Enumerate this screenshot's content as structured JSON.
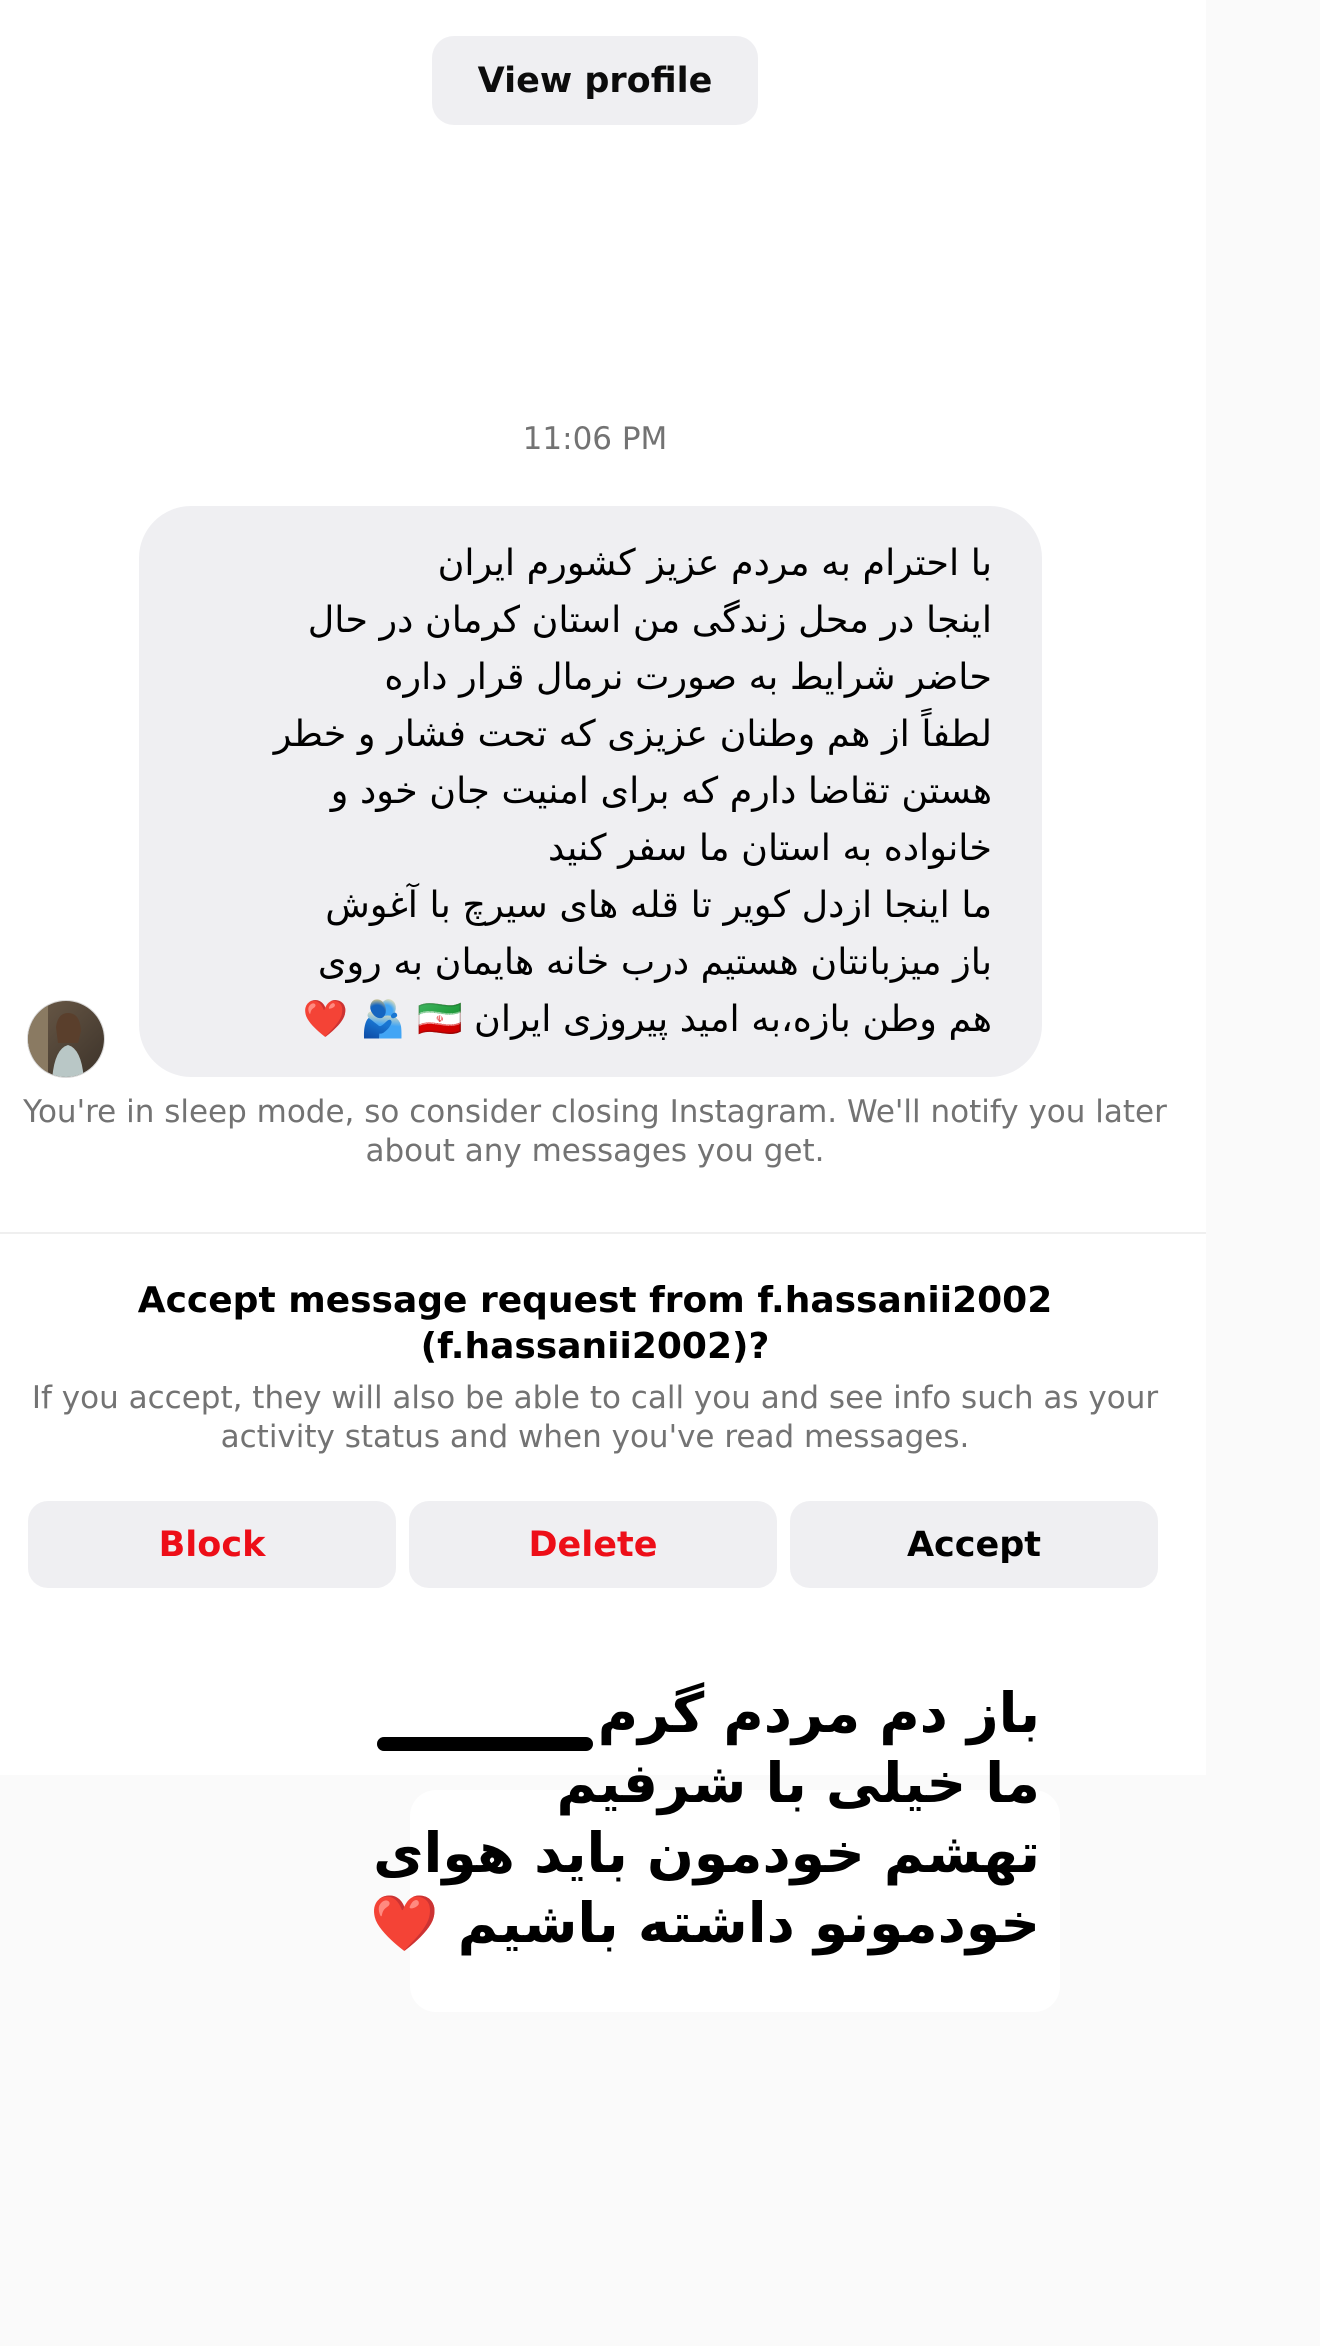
{
  "header": {
    "view_profile_label": "View profile"
  },
  "thread": {
    "timestamp": "11:06 PM",
    "message": {
      "lines": [
        "با احترام به مردم عزیز کشورم ایران",
        "اینجا در محل زندگی من استان کرمان در حال",
        "حاضر شرایط به صورت نرمال قرار داره",
        "لطفاً از هم وطنان عزیزی که تحت فشار و خطر",
        "هستن تقاضا دارم که برای امنیت جان خود و",
        "خانواده به استان ما سفر کنید",
        "ما اینجا ازدل کویر تا قله های سیرچ با آغوش",
        "باز میزبانتان هستیم درب خانه هایمان به روی",
        "هم وطن بازه،به امید پیروزی ایران 🇮🇷 🫂 ❤️"
      ]
    },
    "sleep_notice": "You're in sleep mode, so consider closing Instagram. We'll notify you later about any messages you get."
  },
  "request": {
    "title": "Accept message request from f.hassanii2002 (f.hassanii2002)?",
    "description": "If you accept, they will also be able to call you and see info such as your activity status and when you've read messages.",
    "buttons": {
      "block": "Block",
      "delete": "Delete",
      "accept": "Accept"
    }
  },
  "overlay_caption": {
    "lines": [
      "باز دم مردم گرم",
      "ما خیلی با شرفیم",
      "تهشم خودمون باید هوای",
      "خودمونو داشته باشیم ❤️"
    ]
  },
  "colors": {
    "destructive": "#ed0e18",
    "bubble_bg": "#efeff2",
    "muted_text": "#737373",
    "button_bg": "#efeff2"
  }
}
